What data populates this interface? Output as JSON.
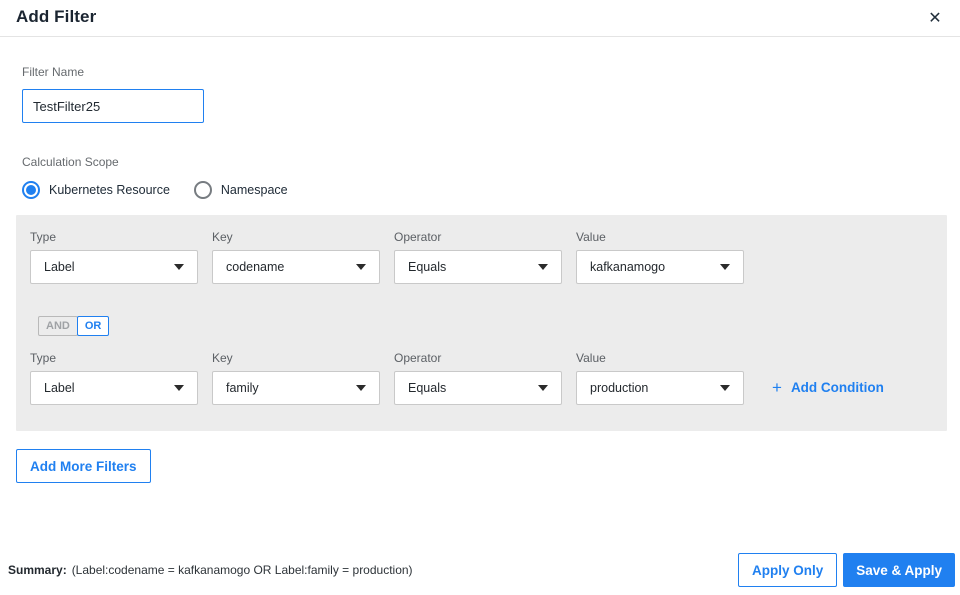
{
  "dialog": {
    "title": "Add Filter",
    "close_icon": "✕"
  },
  "filter_name": {
    "label": "Filter Name",
    "value": "TestFilter25"
  },
  "calculation_scope": {
    "label": "Calculation Scope",
    "options": [
      {
        "label": "Kubernetes Resource",
        "selected": true
      },
      {
        "label": "Namespace",
        "selected": false
      }
    ]
  },
  "conditions": {
    "field_labels": {
      "type": "Type",
      "key": "Key",
      "operator": "Operator",
      "value": "Value"
    },
    "rows": [
      {
        "type": "Label",
        "key": "codename",
        "operator": "Equals",
        "value": "kafkanamogo"
      },
      {
        "type": "Label",
        "key": "family",
        "operator": "Equals",
        "value": "production"
      }
    ],
    "join_toggle": {
      "and_label": "AND",
      "or_label": "OR",
      "selected": "OR"
    },
    "plus_icon": "+",
    "add_condition_label": "Add Condition"
  },
  "add_more_filters_label": "Add More Filters",
  "footer": {
    "summary_label": "Summary:",
    "summary_text": "(Label:codename = kafkanamogo OR Label:family = production)",
    "apply_only_label": "Apply Only",
    "save_apply_label": "Save & Apply"
  },
  "colors": {
    "accent": "#2080f0",
    "panel_background": "#ececec"
  }
}
